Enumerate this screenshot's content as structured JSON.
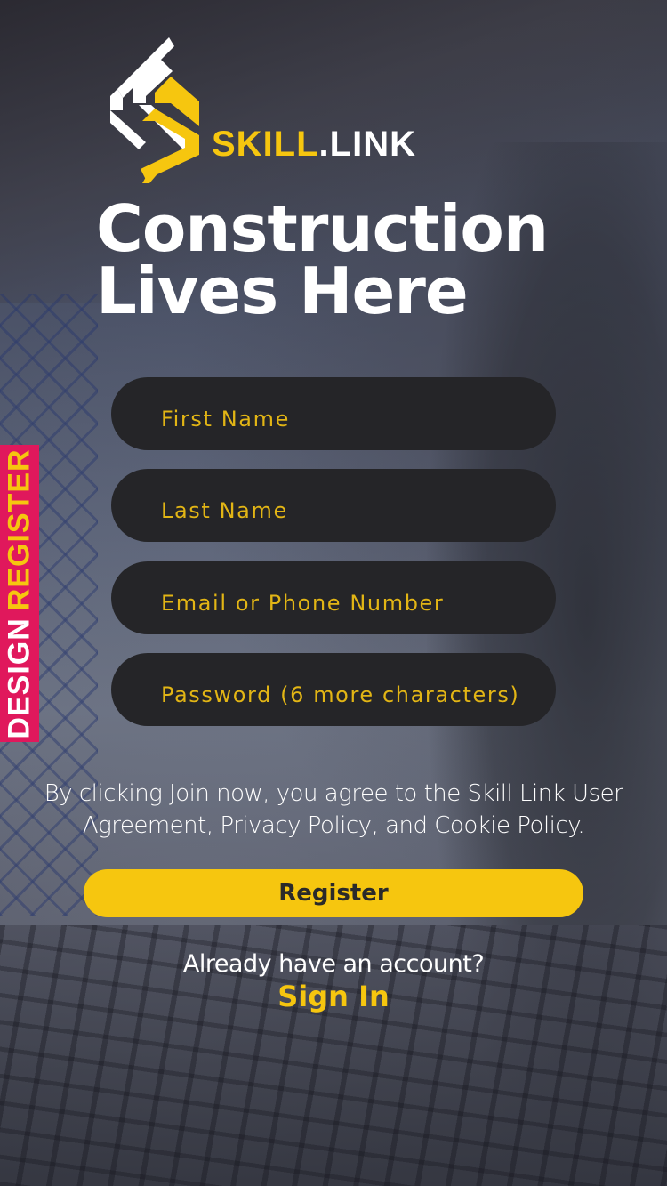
{
  "brand": {
    "name_part1": "SKILL",
    "name_part2": ".LINK",
    "logo_icon": "skill-link-logo-icon",
    "colors": {
      "accent": "#f6c60f",
      "field_bg": "#252528",
      "side_tab": "#e0185c",
      "text": "#ffffff"
    }
  },
  "headline": "Construction Lives Here",
  "form": {
    "first_name_placeholder": "First Name",
    "last_name_placeholder": "Last Name",
    "contact_placeholder": "Email or Phone Number",
    "password_placeholder": "Password (6 more characters)"
  },
  "terms_text": "By clicking Join now, you agree to the Skill Link User Agreement, Privacy Policy, and Cookie Policy.",
  "register_label": "Register",
  "already_text": "Already have an account?",
  "signin_label": "Sign In",
  "side_tab": {
    "word1": "DESIGN",
    "word2": "REGISTER"
  }
}
